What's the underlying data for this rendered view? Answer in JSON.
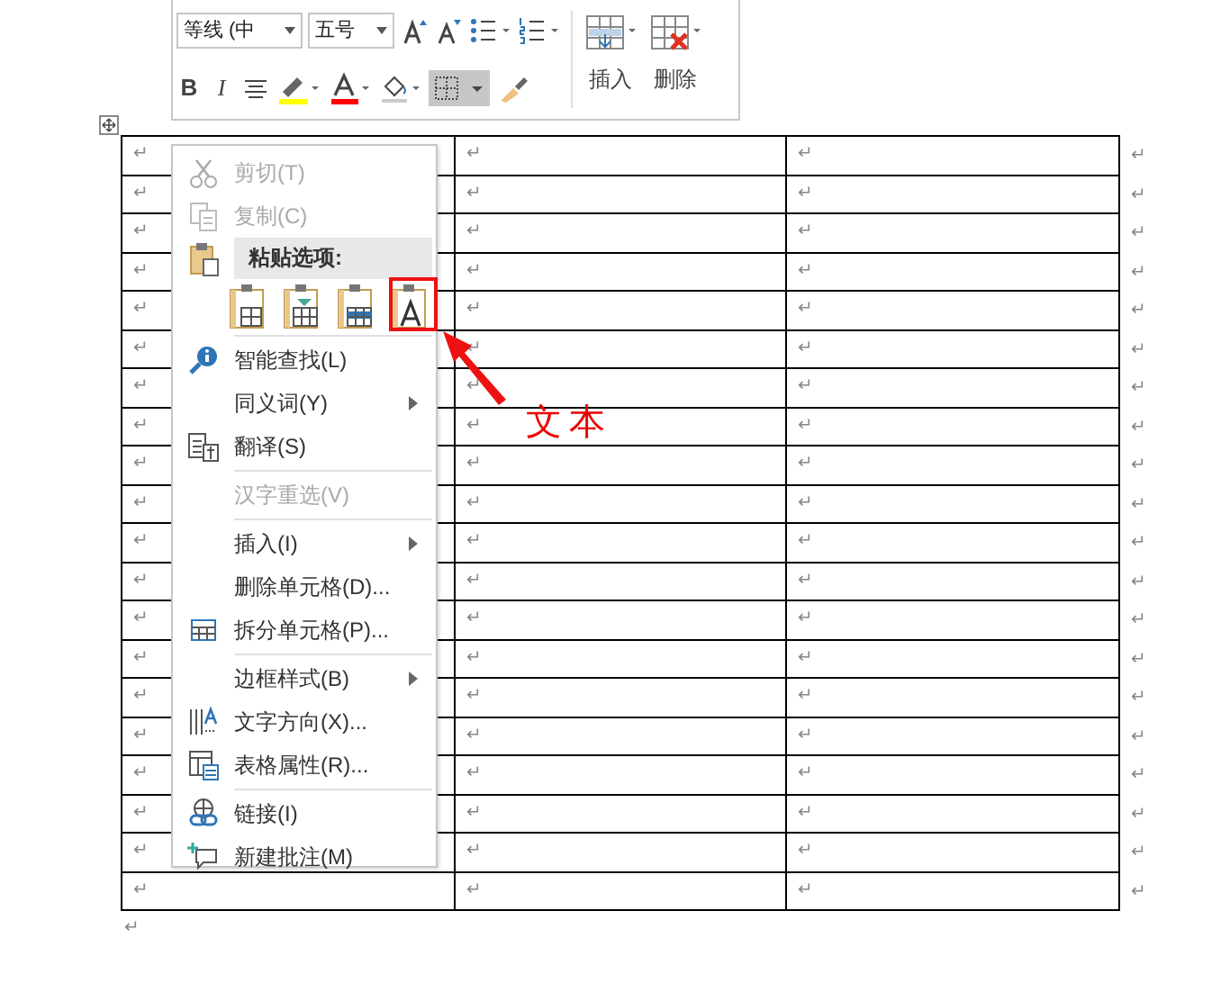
{
  "toolbar": {
    "font": "等线 (中",
    "size": "五号",
    "bold": "B",
    "italic": "I",
    "insert_label": "插入",
    "delete_label": "删除"
  },
  "table": {
    "rows": [
      {
        "cells": [
          "↵",
          "↵",
          "↵"
        ],
        "end": "↵"
      },
      {
        "cells": [
          "↵",
          "↵",
          "↵"
        ],
        "end": "↵"
      },
      {
        "cells": [
          "↵",
          "↵",
          "↵"
        ],
        "end": "↵"
      },
      {
        "cells": [
          "↵",
          "↵",
          "↵"
        ],
        "end": "↵"
      },
      {
        "cells": [
          "↵",
          "↵",
          "↵"
        ],
        "end": "↵"
      },
      {
        "cells": [
          "↵",
          "↵",
          "↵"
        ],
        "end": "↵"
      },
      {
        "cells": [
          "↵",
          "↵",
          "↵"
        ],
        "end": "↵"
      },
      {
        "cells": [
          "↵",
          "↵",
          "↵"
        ],
        "end": "↵"
      },
      {
        "cells": [
          "↵",
          "↵",
          "↵"
        ],
        "end": "↵"
      },
      {
        "cells": [
          "↵",
          "↵",
          "↵"
        ],
        "end": "↵"
      },
      {
        "cells": [
          "↵",
          "↵",
          "↵"
        ],
        "end": "↵"
      },
      {
        "cells": [
          "↵",
          "↵",
          "↵"
        ],
        "end": "↵"
      },
      {
        "cells": [
          "↵",
          "↵",
          "↵"
        ],
        "end": "↵"
      },
      {
        "cells": [
          "↵",
          "↵",
          "↵"
        ],
        "end": "↵"
      },
      {
        "cells": [
          "↵",
          "↵",
          "↵"
        ],
        "end": "↵"
      },
      {
        "cells": [
          "↵",
          "↵",
          "↵"
        ],
        "end": "↵"
      },
      {
        "cells": [
          "↵",
          "↵",
          "↵"
        ],
        "end": "↵"
      },
      {
        "cells": [
          "↵",
          "↵",
          "↵"
        ],
        "end": "↵"
      },
      {
        "cells": [
          "↵",
          "↵",
          "↵"
        ],
        "end": "↵"
      },
      {
        "cells": [
          "↵",
          "↵",
          "↵"
        ],
        "end": "↵"
      }
    ],
    "after": "↵"
  },
  "context_menu": {
    "items": [
      {
        "kind": "command",
        "label": "剪切(T)",
        "disabled": true,
        "submenu": false
      },
      {
        "kind": "command",
        "label": "复制(C)",
        "disabled": true,
        "submenu": false
      },
      {
        "kind": "header",
        "label": "粘贴选项:"
      },
      {
        "kind": "paste_row"
      },
      {
        "kind": "separator"
      },
      {
        "kind": "command",
        "label": "智能查找(L)",
        "disabled": false,
        "submenu": false
      },
      {
        "kind": "command",
        "label": "同义词(Y)",
        "disabled": false,
        "submenu": true
      },
      {
        "kind": "command",
        "label": "翻译(S)",
        "disabled": false,
        "submenu": false
      },
      {
        "kind": "separator"
      },
      {
        "kind": "command",
        "label": "汉字重选(V)",
        "disabled": true,
        "submenu": false
      },
      {
        "kind": "separator"
      },
      {
        "kind": "command",
        "label": "插入(I)",
        "disabled": false,
        "submenu": true
      },
      {
        "kind": "command",
        "label": "删除单元格(D)...",
        "disabled": false,
        "submenu": false
      },
      {
        "kind": "command",
        "label": "拆分单元格(P)...",
        "disabled": false,
        "submenu": false
      },
      {
        "kind": "separator"
      },
      {
        "kind": "command",
        "label": "边框样式(B)",
        "disabled": false,
        "submenu": true
      },
      {
        "kind": "command",
        "label": "文字方向(X)...",
        "disabled": false,
        "submenu": false
      },
      {
        "kind": "command",
        "label": "表格属性(R)...",
        "disabled": false,
        "submenu": false
      },
      {
        "kind": "separator"
      },
      {
        "kind": "command",
        "label": "链接(I)",
        "disabled": false,
        "submenu": false
      },
      {
        "kind": "command",
        "label": "新建批注(M)",
        "disabled": false,
        "submenu": false
      }
    ]
  },
  "annotation": {
    "label": "文本"
  }
}
